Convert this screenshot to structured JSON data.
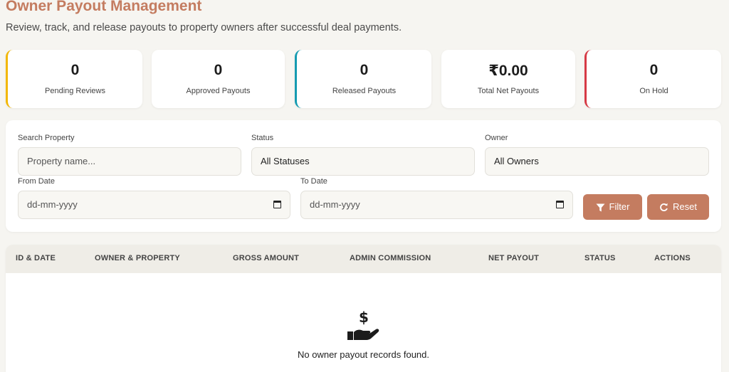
{
  "header": {
    "title": "Owner Payout Management",
    "subtitle": "Review, track, and release payouts to property owners after successful deal payments."
  },
  "stats": [
    {
      "value": "0",
      "label": "Pending Reviews",
      "accent": "#f2b705"
    },
    {
      "value": "0",
      "label": "Approved Payouts",
      "accent": ""
    },
    {
      "value": "0",
      "label": "Released Payouts",
      "accent": "#159bb1"
    },
    {
      "value": "₹0.00",
      "label": "Total Net Payouts",
      "accent": ""
    },
    {
      "value": "0",
      "label": "On Hold",
      "accent": "#d63a45"
    }
  ],
  "filters": {
    "search": {
      "label": "Search Property",
      "placeholder": "Property name..."
    },
    "status": {
      "label": "Status",
      "value": "All Statuses"
    },
    "owner": {
      "label": "Owner",
      "value": "All Owners"
    },
    "from_date": {
      "label": "From Date",
      "placeholder": "dd-mm-yyyy"
    },
    "to_date": {
      "label": "To Date",
      "placeholder": "dd-mm-yyyy"
    },
    "filter_button": "Filter",
    "reset_button": "Reset"
  },
  "table": {
    "columns": [
      "ID & DATE",
      "OWNER & PROPERTY",
      "GROSS AMOUNT",
      "ADMIN COMMISSION",
      "NET PAYOUT",
      "STATUS",
      "ACTIONS"
    ],
    "empty_icon": "hand-holding-dollar-icon",
    "empty_message": "No owner payout records found."
  },
  "colors": {
    "brand": "#c47c60",
    "background": "#f6f5f1"
  }
}
